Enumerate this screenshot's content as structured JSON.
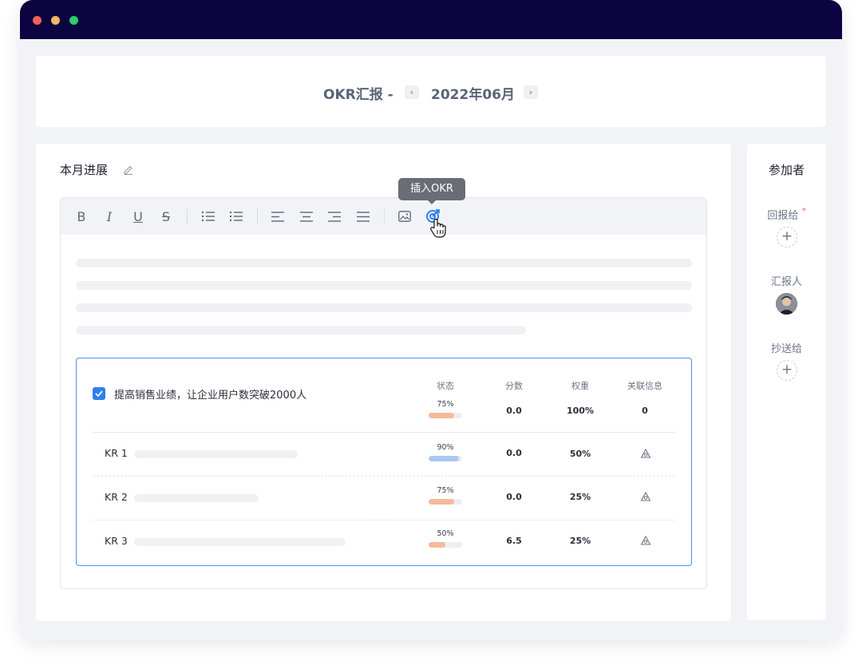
{
  "window": {
    "controls": [
      "close",
      "minimize",
      "maximize"
    ]
  },
  "header": {
    "title": "OKR汇报 -",
    "period": "2022年06月",
    "prev_icon": "‹",
    "next_icon": "›"
  },
  "main": {
    "section_title": "本月进展",
    "toolbar": {
      "bold": "B",
      "italic": "I",
      "underline": "U",
      "strike": "S",
      "tooltip": "插入OKR"
    },
    "okr": {
      "objective": "提高销售业绩，让企业用户数突破2000人",
      "columns": {
        "status": "状态",
        "score": "分数",
        "weight": "权重",
        "links": "关联信息"
      },
      "objective_row": {
        "progress": 0.75,
        "progress_label": "75%",
        "score": "0.0",
        "weight": "100%",
        "links": "0"
      },
      "krs": [
        {
          "label": "KR 1",
          "progress": 0.9,
          "progress_label": "90%",
          "score": "0.0",
          "weight": "50%",
          "color": "#a9c8f5"
        },
        {
          "label": "KR 2",
          "progress": 0.75,
          "progress_label": "75%",
          "score": "0.0",
          "weight": "25%",
          "color": "#f5b99b"
        },
        {
          "label": "KR 3",
          "progress": 0.5,
          "progress_label": "50%",
          "score": "6.5",
          "weight": "25%",
          "color": "#f5b99b"
        }
      ],
      "objective_color": "#f5b99b"
    }
  },
  "sidebar": {
    "title": "参加者",
    "report_to": "回报给",
    "required_mark": "*",
    "reporter": "汇报人",
    "cc": "抄送给",
    "add": "+"
  }
}
